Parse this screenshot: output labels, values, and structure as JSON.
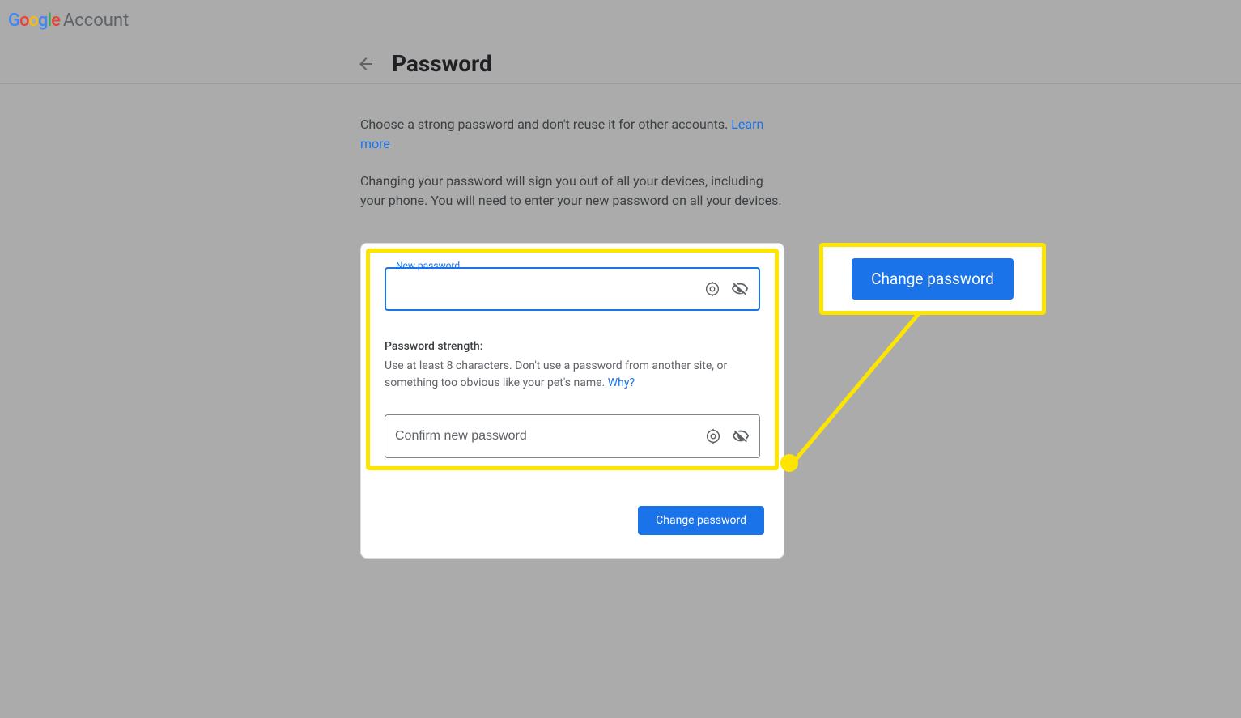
{
  "brand": {
    "product": "Account"
  },
  "page": {
    "title": "Password",
    "intro": "Choose a strong password and don't reuse it for other accounts. ",
    "learn_more": "Learn more",
    "description": "Changing your password will sign you out of all your devices, including your phone. You will need to enter your new password on all your devices."
  },
  "form": {
    "new_password_label": "New password",
    "new_password_value": "",
    "strength_label": "Password strength:",
    "strength_desc": "Use at least 8 characters. Don't use a password from another site, or something too obvious like your pet's name. ",
    "why_link": "Why?",
    "confirm_placeholder": "Confirm new password",
    "confirm_value": "",
    "submit_label": "Change password"
  },
  "callout": {
    "button_label": "Change password"
  }
}
